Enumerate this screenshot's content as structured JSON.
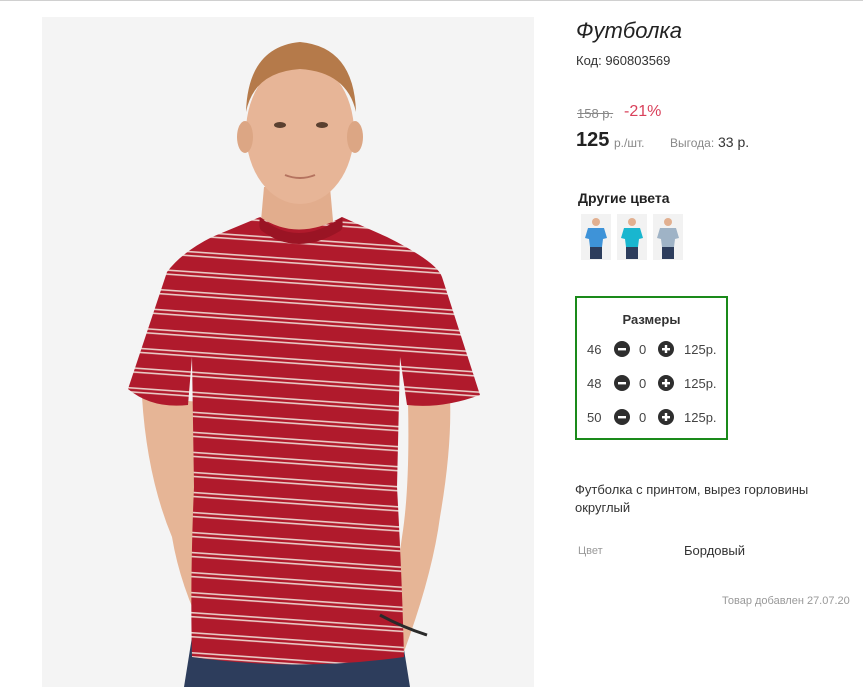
{
  "product": {
    "title": "Футболка",
    "code": "Код: 960803569",
    "old_price": "158 р.",
    "discount": "-21%",
    "price": "125",
    "price_unit": "р./шт.",
    "saving_label": "Выгода:",
    "saving_value": "33 р.",
    "description": "Футболка с принтом, вырез горловины округлый",
    "added_text": "Товар добавлен 27.07.20"
  },
  "other_colors": {
    "title": "Другие цвета",
    "swatches": [
      {
        "name": "blue",
        "color": "#3e93d8"
      },
      {
        "name": "turquoise",
        "color": "#19b6cf"
      },
      {
        "name": "grey-blue",
        "color": "#9fb3c6"
      }
    ]
  },
  "sizes": {
    "title": "Размеры",
    "rows": [
      {
        "size": "46",
        "qty": "0",
        "price": "125р."
      },
      {
        "size": "48",
        "qty": "0",
        "price": "125р."
      },
      {
        "size": "50",
        "qty": "0",
        "price": "125р."
      }
    ]
  },
  "attributes": {
    "color_label": "Цвет",
    "color_value": "Бордовый"
  },
  "colors": {
    "shirt": "#b01a2c",
    "stripe": "#e9c9c4",
    "sizes_border": "#1a8a1a",
    "discount": "#d9405a"
  }
}
